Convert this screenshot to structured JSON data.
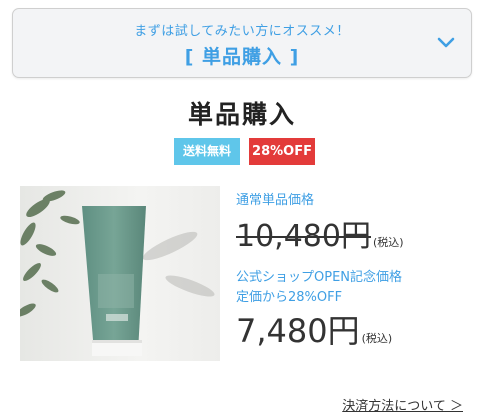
{
  "accordion": {
    "subtitle": "まずは試してみたい方にオススメ！",
    "title": "[ 単品購入 ]",
    "icon": "chevron-down-icon"
  },
  "section": {
    "title": "単品購入",
    "badges": [
      "送料無料",
      "28%OFF"
    ]
  },
  "product": {
    "image_icon": "product-tube-image",
    "regular_label": "通常単品価格",
    "regular_price": "10,480円",
    "regular_tax": "(税込)",
    "campaign_line1": "公式ショップOPEN記念価格",
    "campaign_line2": "定価から28%OFF",
    "sale_price": "7,480円",
    "sale_tax": "(税込)"
  },
  "footer": {
    "link": "決済方法について ＞"
  },
  "colors": {
    "accent": "#3f9fe4",
    "badge_blue": "#5fc6ea",
    "badge_red": "#e33b3a"
  }
}
